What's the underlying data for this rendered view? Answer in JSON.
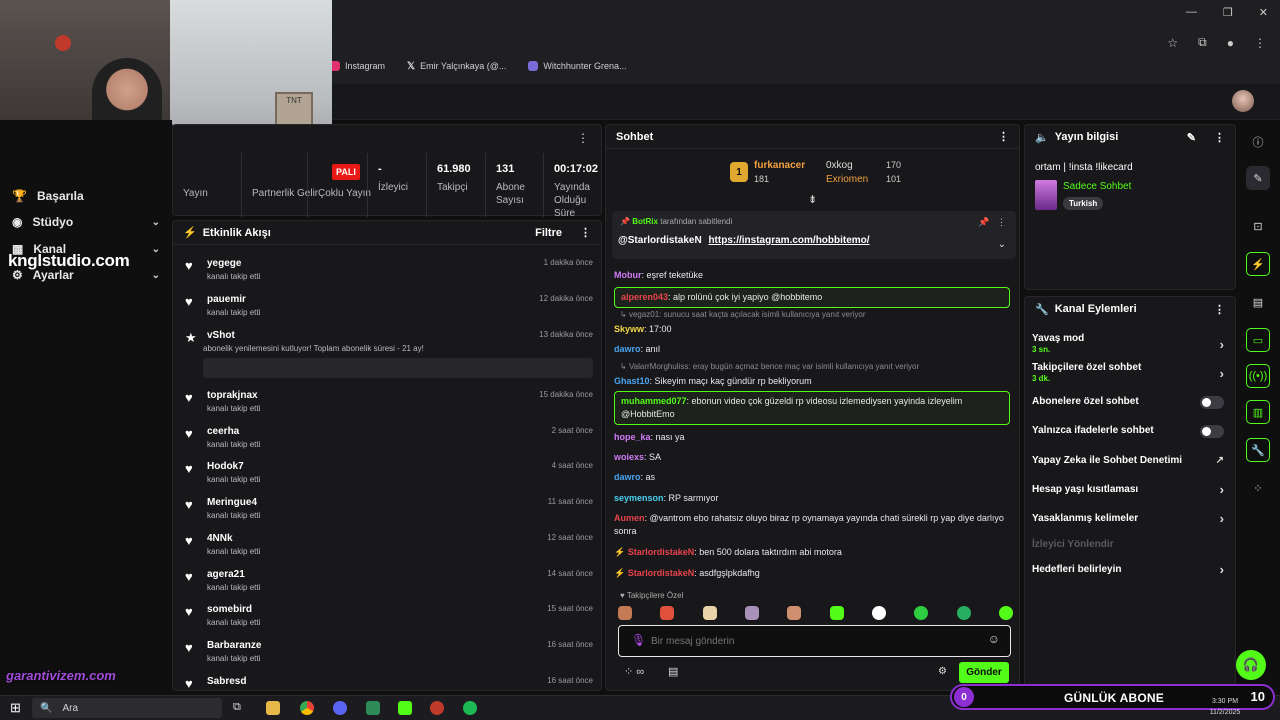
{
  "bookmarks": [
    {
      "label": "Instagram",
      "icon": "instagram-icon",
      "color": "#e1306c"
    },
    {
      "label": "Emir Yalçınkaya (@...",
      "icon": "x-icon",
      "color": "#ffffff"
    },
    {
      "label": "Witchhunter Grena...",
      "icon": "shield-icon",
      "color": "#7b6bd8"
    }
  ],
  "sidebar": {
    "items": [
      {
        "label": "Başarıla",
        "icon": "trophy-icon"
      },
      {
        "label": "Stüdyo",
        "icon": "studio-icon"
      },
      {
        "label": "Kanal",
        "icon": "grid-icon"
      },
      {
        "label": "Ayarlar",
        "icon": "gear-icon"
      }
    ],
    "watermark": "knglstudio.com",
    "brand_overlay": "garantivizem.com"
  },
  "stats": {
    "badge": "PALI",
    "columns": [
      {
        "value": "",
        "label": "Yayın"
      },
      {
        "value": "",
        "label": "Partnerlik Gelir"
      },
      {
        "value": "",
        "label": "Çoklu Yayın"
      },
      {
        "value": "-",
        "label": "İzleyici"
      },
      {
        "value": "61.980",
        "label": "Takipçi"
      },
      {
        "value": "131",
        "label": "Abone Sayısı"
      },
      {
        "value": "00:17:02",
        "label": "Yayında Olduğu Süre"
      }
    ]
  },
  "activity": {
    "title": "Etkinlik Akışı",
    "filter_label": "Filtre",
    "items": [
      {
        "name": "yegege",
        "sub": "kanalı takip etti",
        "time": "1 dakika önce"
      },
      {
        "name": "pauemir",
        "sub": "kanalı takip etti",
        "time": "12 dakika önce"
      },
      {
        "name": "vShot",
        "sub": "abonelik yenilemesini kutluyor! Toplam abonelik süresi - 21 ay!",
        "time": "13 dakika önce"
      },
      {
        "name": "toprakjnax",
        "sub": "kanalı takip etti",
        "time": "15 dakika önce"
      },
      {
        "name": "ceerha",
        "sub": "kanalı takip etti",
        "time": "2 saat önce"
      },
      {
        "name": "Hodok7",
        "sub": "kanalı takip etti",
        "time": "4 saat önce"
      },
      {
        "name": "Meringue4",
        "sub": "kanalı takip etti",
        "time": "11 saat önce"
      },
      {
        "name": "4NNk",
        "sub": "kanalı takip etti",
        "time": "12 saat önce"
      },
      {
        "name": "agera21",
        "sub": "kanalı takip etti",
        "time": "14 saat önce"
      },
      {
        "name": "somebird",
        "sub": "kanalı takip etti",
        "time": "15 saat önce"
      },
      {
        "name": "Barbaranze",
        "sub": "kanalı takip etti",
        "time": "16 saat önce"
      },
      {
        "name": "Sabresd",
        "sub": "",
        "time": "16 saat önce"
      }
    ]
  },
  "chat": {
    "title": "Sohbet",
    "leader": {
      "rank": "1",
      "name": "furkanacer",
      "score": "181",
      "second_name": "0xkog",
      "second_score": "170",
      "third_name": "Exriomen",
      "third_score": "101"
    },
    "pinned": {
      "author": "BotRix",
      "by_text": "tarafından sabitlendi",
      "mention": "@StarlordistakeN",
      "link": "https://instagram.com/hobbitemo/"
    },
    "messages": [
      {
        "user": "Mobur",
        "color": "#d07bf5",
        "text": "eşref teketüke",
        "hl": false
      },
      {
        "user": "alperen043",
        "color": "#e8434c",
        "text": "alp rolünü çok iyi yapiyo @hobbitemo",
        "hl": true
      },
      {
        "reply": "vegaz01: sunucu saat kaçta açılacak isimli kullanıcıya yanıt veriyor"
      },
      {
        "user": "Skyww",
        "color": "#f0d84a",
        "text": "17:00",
        "hl": false
      },
      {
        "user": "dawro",
        "color": "#4aa3f0",
        "text": "anıl",
        "hl": false
      },
      {
        "reply": "ValarrMorghuliss: eray bugün açmaz bence maç var isimli kullanıcıya yanıt veriyor"
      },
      {
        "user": "Ghast10",
        "color": "#4aa3f0",
        "text": "Sikeyim maçı kaç gündür rp bekliyorum",
        "hl": false
      },
      {
        "user": "muhammed077",
        "color": "#53fc18",
        "text": "ebonun video çok güzeldi rp videosu izlemediysen yayinda izleyelim @HobbitEmo",
        "hl": true
      },
      {
        "user": "hope_ka",
        "color": "#d07bf5",
        "text": "nası ya",
        "hl": false
      },
      {
        "user": "woiexs",
        "color": "#d07bf5",
        "text": "SA",
        "hl": false
      },
      {
        "user": "dawro",
        "color": "#4aa3f0",
        "text": "as",
        "hl": false
      },
      {
        "user": "seymenson",
        "color": "#4ad0f0",
        "text": "RP sarmıyor",
        "hl": false
      },
      {
        "user": "Aumen",
        "color": "#e8434c",
        "text": "@vantrom ebo rahatsız oluyo biraz rp oynamaya yayında chati sürekli rp yap diye darlıyo sonra",
        "hl": false
      },
      {
        "user": "StarlordistakeN",
        "color": "#e8434c",
        "text": "ben 500 dolara taktırdım abi motora",
        "hl": false
      },
      {
        "user": "StarlordistakeN",
        "color": "#e8434c",
        "text": "asdfgşlpkdafhg",
        "hl": false
      }
    ],
    "followers_only_label": "Takipçilere Özel",
    "input_placeholder": "Bir mesaj gönderin",
    "send_label": "Gönder"
  },
  "stream_info": {
    "title": "Yayın bilgisi",
    "stream_title": "ortam | !insta !likecard",
    "category": "Sadece Sohbet",
    "tag": "Turkish"
  },
  "channel_actions": {
    "title": "Kanal Eylemleri",
    "rows": [
      {
        "label": "Yavaş mod",
        "sub": "3 sn.",
        "control": "chevron"
      },
      {
        "label": "Takipçilere özel sohbet",
        "sub": "3 dk.",
        "control": "chevron"
      },
      {
        "label": "Abonelere özel sohbet",
        "sub": "",
        "control": "toggle"
      },
      {
        "label": "Yalnızca ifadelerle sohbet",
        "sub": "",
        "control": "toggle"
      },
      {
        "label": "Yapay Zeka ile Sohbet Denetimi",
        "sub": "",
        "control": "external"
      },
      {
        "label": "Hesap yaşı kısıtlaması",
        "sub": "",
        "control": "chevron"
      },
      {
        "label": "Yasaklanmış kelimeler",
        "sub": "",
        "control": "chevron"
      },
      {
        "label": "İzleyici Yönlendir",
        "sub": "",
        "control": "none"
      },
      {
        "label": "Hedefleri belirleyin",
        "sub": "",
        "control": "chevron"
      }
    ]
  },
  "taskbar": {
    "search_placeholder": "Ara",
    "time": "3:30 PM",
    "date": "11/2/2025"
  },
  "sub_goal": {
    "count": "0",
    "title": "GÜNLÜK ABONE",
    "goal": "10"
  },
  "colors": {
    "accent": "#53fc18",
    "purple": "#8c2ed2"
  }
}
